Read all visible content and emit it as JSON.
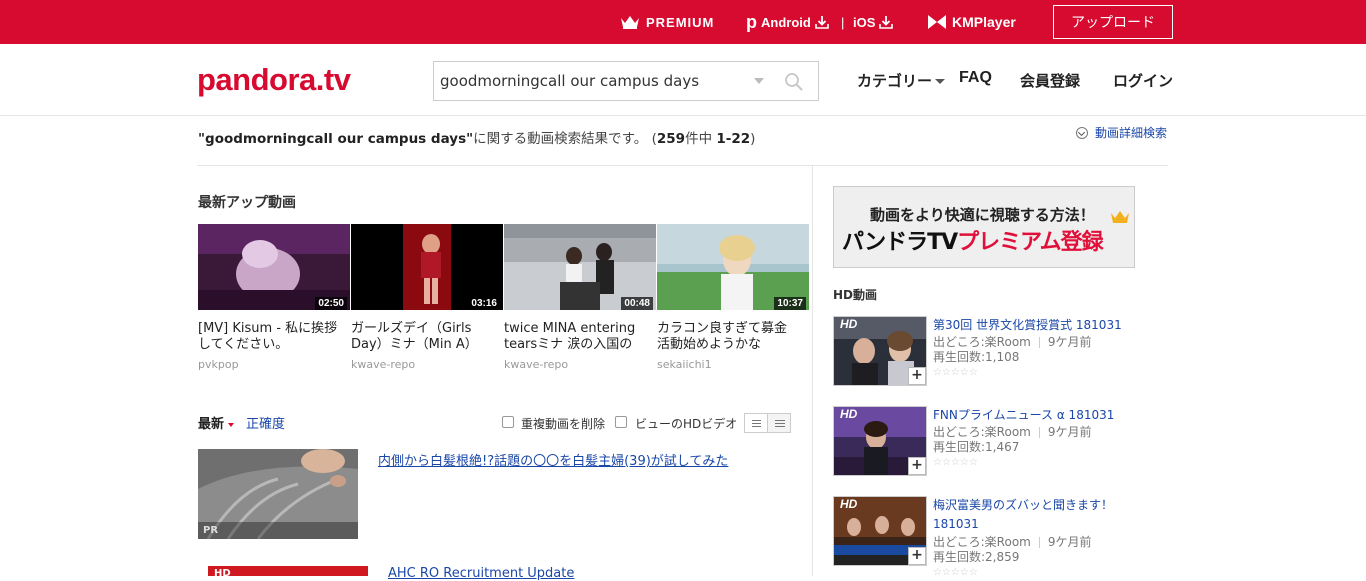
{
  "topbar": {
    "premium": "PREMIUM",
    "android": "Android",
    "android_icon": "p-logo-icon",
    "separator": "|",
    "ios": "iOS",
    "kmplayer": "KMPlayer",
    "upload": "アップロード"
  },
  "header": {
    "logo": "pandora.tv",
    "search_value": "goodmorningcall our campus days",
    "nav": {
      "category": "カテゴリー",
      "faq": "FAQ",
      "register": "会員登録",
      "login": "ログイン"
    }
  },
  "result": {
    "query": "\"goodmorningcall our campus days\"",
    "suffix": "に関する動画検索結果です。",
    "open_paren": "(",
    "count": "259",
    "count_label": "件中",
    "range": "1-22",
    "close_paren": ")",
    "advanced_search": "動画詳細検索"
  },
  "latest": {
    "title": "最新アップ動画",
    "videos": [
      {
        "title": "[MV] Kisum - 私に挨拶してください。",
        "user": "pvkpop",
        "duration": "02:50"
      },
      {
        "title": "ガールズデイ（Girls Day）ミナ（Min A）",
        "user": "kwave-repo",
        "duration": "03:16"
      },
      {
        "title": "twice MINA entering tearsミナ 涙の入国の",
        "user": "kwave-repo",
        "duration": "00:48"
      },
      {
        "title": "カラコン良すぎて募金活動始めようかな",
        "user": "sekaiichi1",
        "duration": "10:37"
      }
    ]
  },
  "sort": {
    "newest": "最新",
    "accuracy": "正確度",
    "remove_duplicates": "重複動画を削除",
    "hd_only": "ビューのHDビデオ"
  },
  "list": {
    "pr_label": "PR",
    "pr_title": "内側から白髪根絶!?話題の〇〇を白髪主婦(39)が試してみた",
    "item2_hd": "HD",
    "item2_title": "AHC RO Recruitment Update"
  },
  "sidebar": {
    "banner_line1": "動画をより快適に視聴する方法！",
    "banner_line2_a": "パンドラTV",
    "banner_line2_b": "プレミアム登録",
    "hd_title": "HD動画",
    "hd_tag": "HD",
    "plus": "+",
    "stars": "☆☆☆☆☆",
    "items": [
      {
        "title": "第30回 世界文化賞授賞式 181031",
        "source": "出どころ:楽Room",
        "ago": "9ケ月前",
        "plays": "再生回数:1,108"
      },
      {
        "title": "FNNプライムニュース α 181031",
        "source": "出どころ:楽Room",
        "ago": "9ケ月前",
        "plays": "再生回数:1,467"
      },
      {
        "title": "梅沢富美男のズバッと聞きます！ 181031",
        "source": "出どころ:楽Room",
        "ago": "9ケ月前",
        "plays": "再生回数:2,859"
      }
    ]
  },
  "colors": {
    "brand_red": "#d70a30",
    "link_blue": "#1a47a8"
  }
}
